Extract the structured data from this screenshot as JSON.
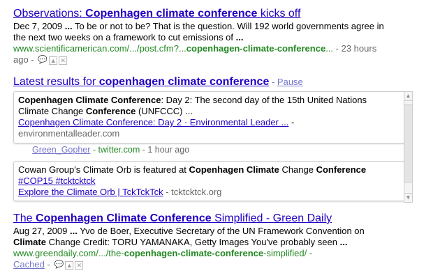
{
  "result1": {
    "title_pre": "Observations: ",
    "title_bold": "Copenhagen climate conference",
    "title_post": " kicks off",
    "date": "Dec 7, 2009",
    "ellipsis": "...",
    "snip1": "To be or not to be? That is the question. Will 192 world governments agree in",
    "snip2": "the next two weeks on a framework to cut emissions of",
    "url_pre": "www.scientificamerican.com/.../post.cfm?...",
    "url_bold": "copenhagen-climate-conference",
    "url_post": "...",
    "age": "- 23 hours",
    "age2": "ago -"
  },
  "latest": {
    "prefix": "Latest results for ",
    "query": "copenhagen climate conference",
    "sep": " - ",
    "pause": "Pause"
  },
  "rt1": {
    "bold1": "Copenhagen Climate Conference",
    "text1": ": Day 2: The second day of the 15th United Nations",
    "text2a": "Climate Change ",
    "bold2": "Conference",
    "text2b": " (UNFCCC) ...",
    "link": "Copenhagen Climate Conference: Day 2 · Environmental Leader ...",
    "link_suffix": " -",
    "domain": "environmentalleader.com",
    "user": "Green_Gopher",
    "source": "- twitter.com",
    "time": "- 1 hour ago"
  },
  "rt2": {
    "text1a": "Cowan Group's Climate Orb is featured at ",
    "bold1": "Copenhagen Climate",
    "text1b": " Change ",
    "bold2": "Conference",
    "tags": "#COP15 #tcktcktck",
    "link": "Explore the Climate Orb | TckTckTck",
    "domain": " - tcktcktck.org"
  },
  "result3": {
    "title_pre": "The ",
    "title_bold": "Copenhagen Climate Conference",
    "title_post": " Simplified - Green Daily",
    "date": "Aug 27, 2009",
    "ellipsis": "...",
    "snip1": "Yvo de Boer, Executive Secretary of the UN Framework Convention on",
    "snip2_bold": "Climate",
    "snip2": " Change Credit: TORU YAMANAKA, Getty Images You've probably seen",
    "url_pre": "www.greendaily.com/.../the-",
    "url_bold": "copenhagen-climate-conference",
    "url_post": "-simplified/ -",
    "cached": "Cached",
    "dash": " -"
  }
}
